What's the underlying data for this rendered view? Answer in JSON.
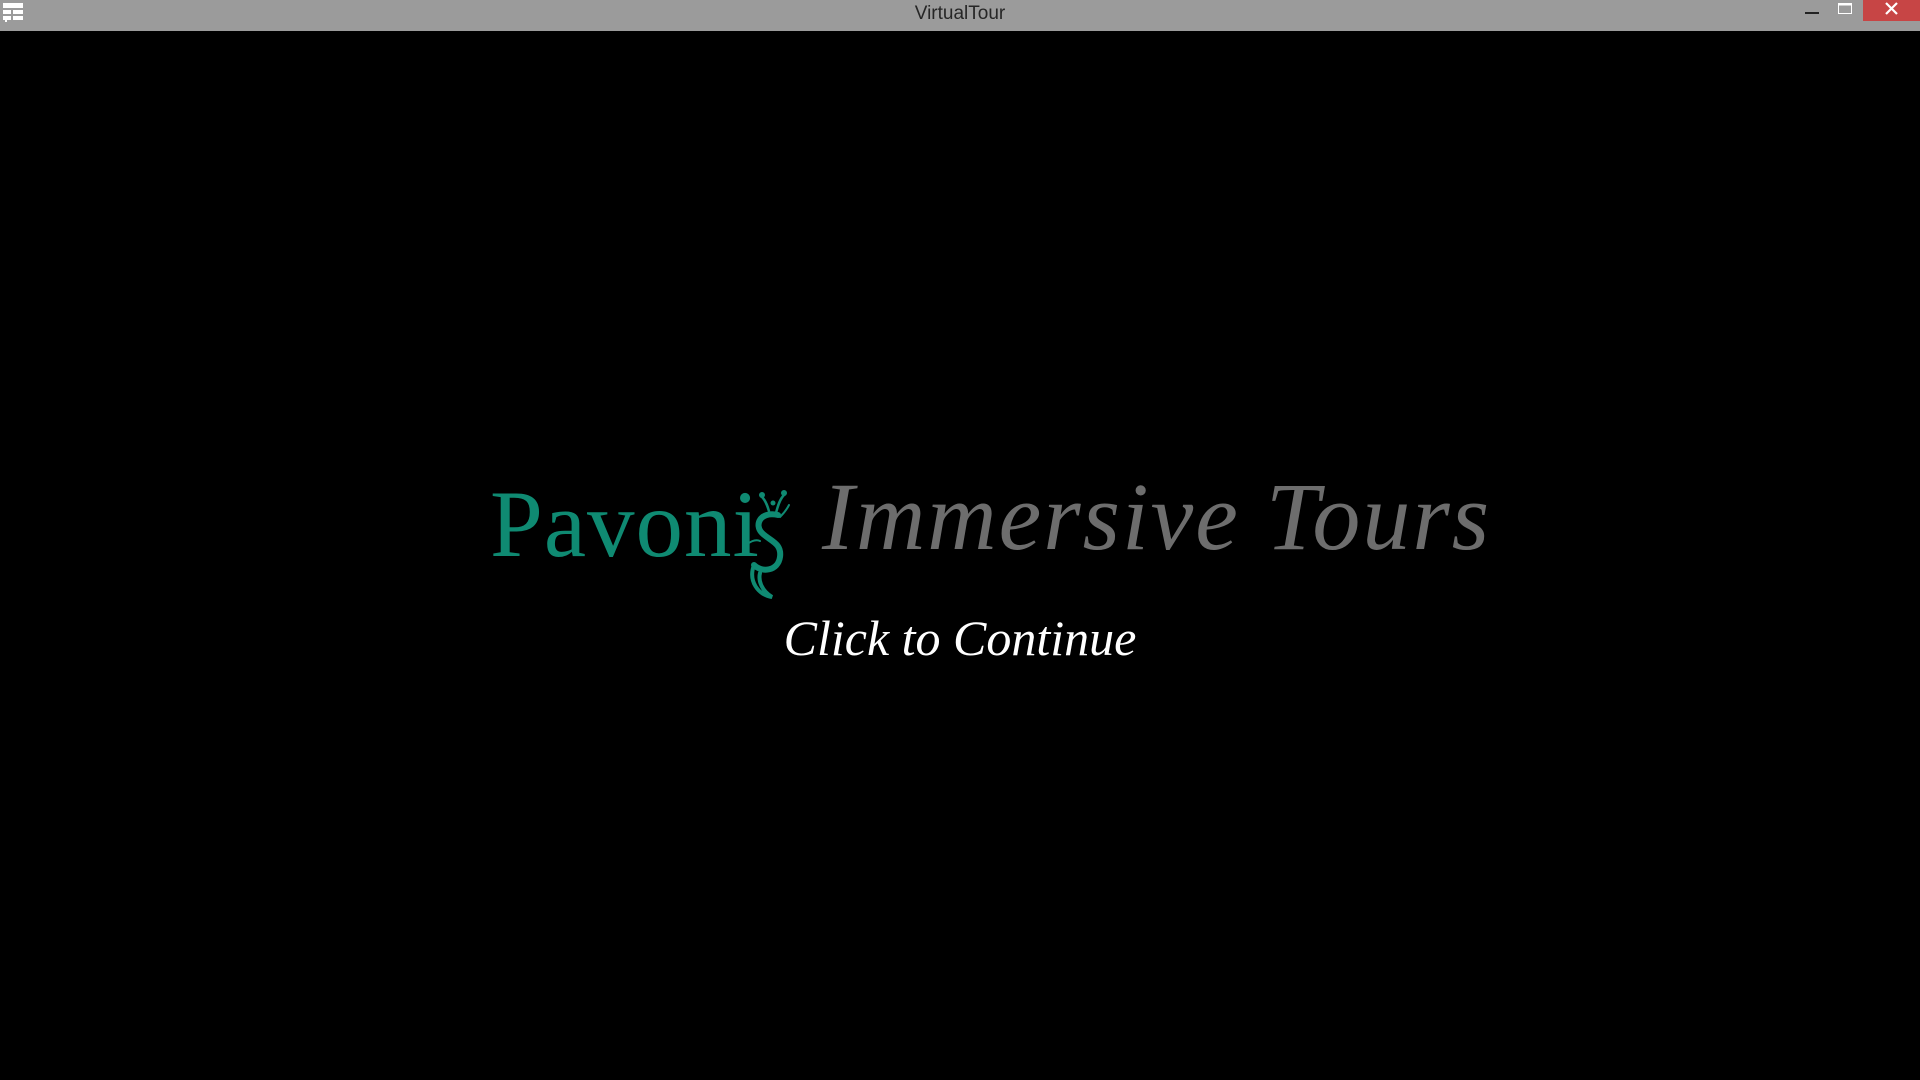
{
  "window": {
    "title": "VirtualTour",
    "controls": {
      "minimize": "minimize-icon",
      "maximize": "maximize-icon",
      "close": "close-icon"
    },
    "app_icon": "app-menu-icon"
  },
  "splash": {
    "brand": "Pavoni",
    "brand_icon": "peacock-s-icon",
    "tagline": "Immersive Tours",
    "call_to_action": "Click to Continue"
  },
  "colors": {
    "titlebar": "#9b9b9b",
    "close_button": "#c74545",
    "background": "#000000",
    "brand": "#0f8a72",
    "tagline": "#6d6d6d",
    "call_to_action": "#ffffff"
  }
}
